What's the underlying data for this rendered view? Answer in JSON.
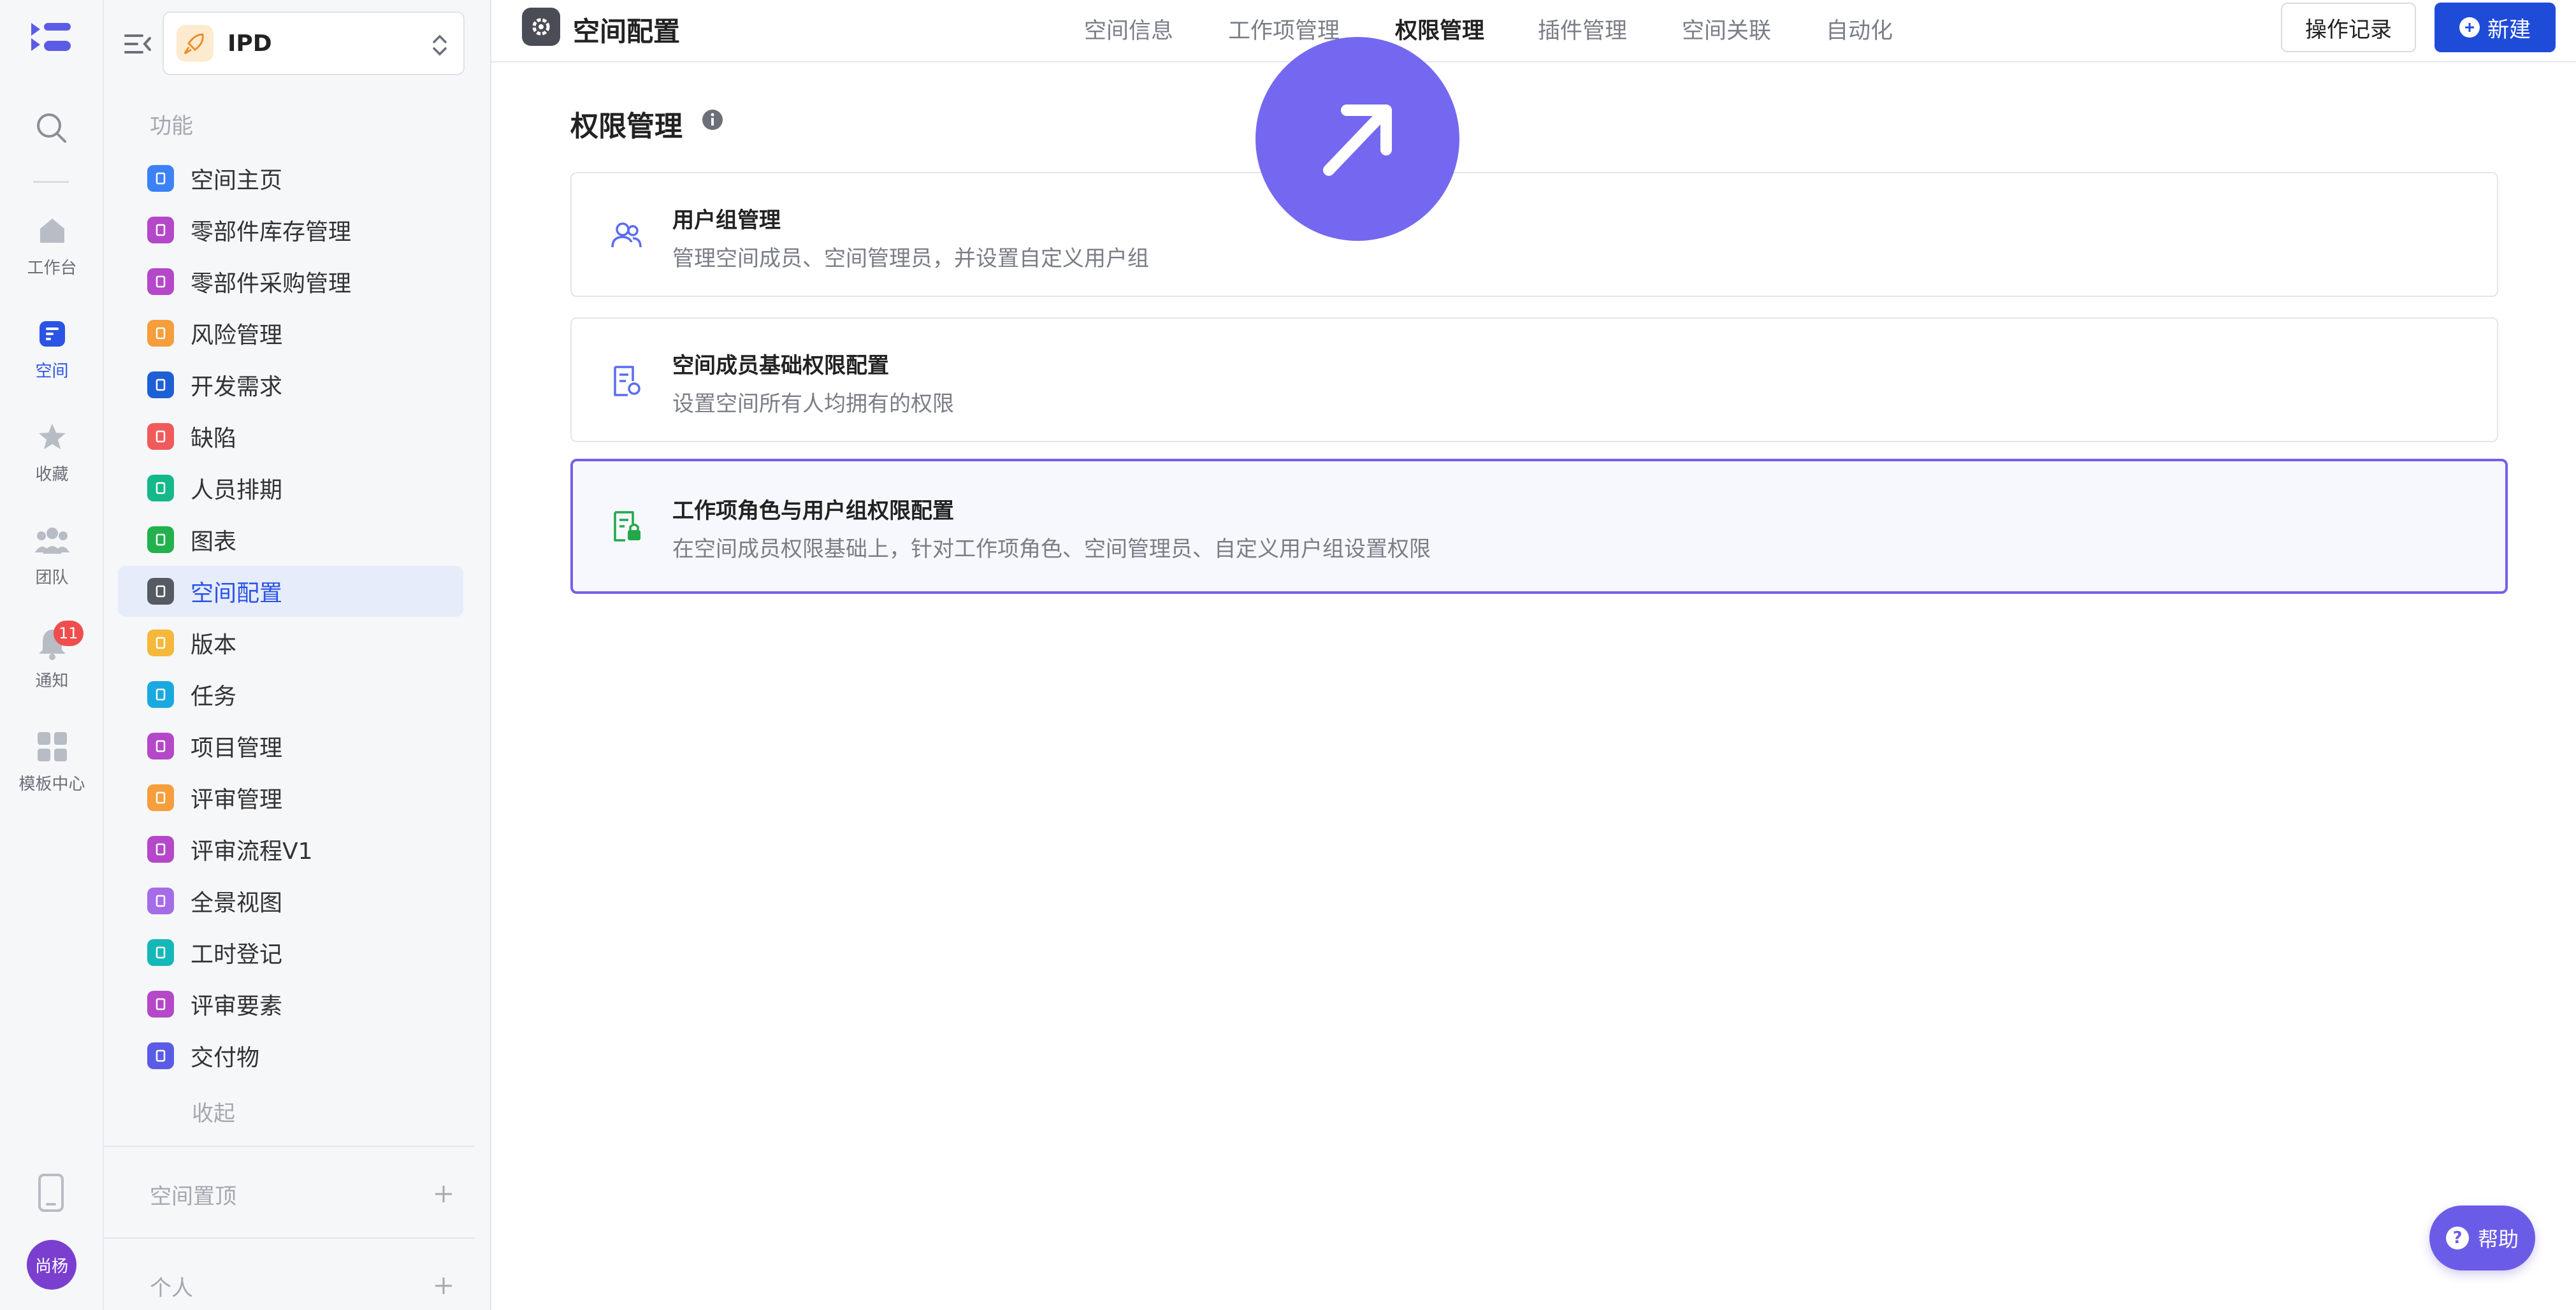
{
  "rail": {
    "items": [
      {
        "label": "工作台"
      },
      {
        "label": "空间"
      },
      {
        "label": "收藏"
      },
      {
        "label": "团队"
      },
      {
        "label": "通知",
        "badge": "11"
      },
      {
        "label": "模板中心"
      }
    ],
    "avatar": "尚杨"
  },
  "sidebar": {
    "space_name": "IPD",
    "section_label": "功能",
    "items": [
      {
        "label": "空间主页",
        "color": "#3b82f6"
      },
      {
        "label": "零部件库存管理",
        "color": "#b547c9"
      },
      {
        "label": "零部件采购管理",
        "color": "#b547c9"
      },
      {
        "label": "风险管理",
        "color": "#f59e3b"
      },
      {
        "label": "开发需求",
        "color": "#1f5fd6"
      },
      {
        "label": "缺陷",
        "color": "#f05a5a"
      },
      {
        "label": "人员排期",
        "color": "#14b88a"
      },
      {
        "label": "图表",
        "color": "#22b14c"
      },
      {
        "label": "空间配置",
        "color": "#555a63"
      },
      {
        "label": "版本",
        "color": "#f5b83b"
      },
      {
        "label": "任务",
        "color": "#1aa8e0"
      },
      {
        "label": "项目管理",
        "color": "#b547c9"
      },
      {
        "label": "评审管理",
        "color": "#f59e3b"
      },
      {
        "label": "评审流程V1",
        "color": "#b547c9"
      },
      {
        "label": "全景视图",
        "color": "#a56ce8"
      },
      {
        "label": "工时登记",
        "color": "#14b8b8"
      },
      {
        "label": "评审要素",
        "color": "#b547c9"
      },
      {
        "label": "交付物",
        "color": "#5b5ce6"
      }
    ],
    "collapse_label": "收起",
    "pinned_label": "空间置顶",
    "personal_label": "个人"
  },
  "topbar": {
    "title": "空间配置",
    "tabs": [
      "空间信息",
      "工作项管理",
      "权限管理",
      "插件管理",
      "空间关联",
      "自动化"
    ],
    "active_tab": "权限管理",
    "log_button": "操作记录",
    "new_button": "新建"
  },
  "main": {
    "title": "权限管理",
    "cards": [
      {
        "title": "用户组管理",
        "desc": "管理空间成员、空间管理员，并设置自定义用户组"
      },
      {
        "title": "空间成员基础权限配置",
        "desc": "设置空间所有人均拥有的权限"
      },
      {
        "title": "工作项角色与用户组权限配置",
        "desc": "在空间成员权限基础上，针对工作项角色、空间管理员、自定义用户组设置权限"
      }
    ]
  },
  "help_label": "帮助",
  "colors": {
    "accent": "#1f4bd9",
    "selected_border": "#7361e8"
  }
}
